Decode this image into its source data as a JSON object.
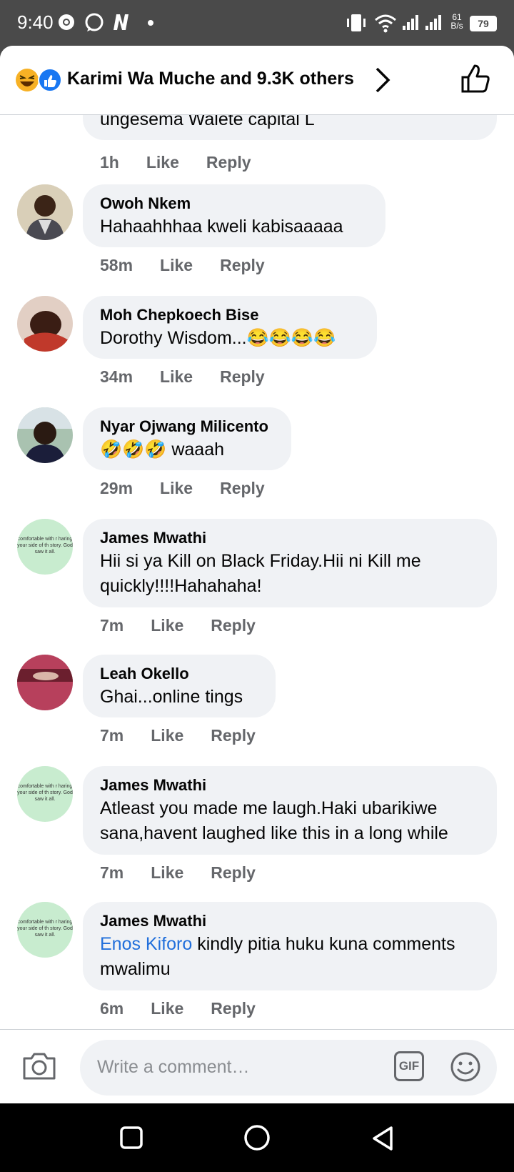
{
  "status_bar": {
    "time": "9:40",
    "speed_top": "61",
    "speed_unit": "B/s",
    "battery": "79"
  },
  "header": {
    "reactions_title": "Karimi Wa Muche and 9.3K others"
  },
  "comments": [
    {
      "name": "",
      "text": "ungesema Walete capital L",
      "time": "1h",
      "like": "Like",
      "reply": "Reply"
    },
    {
      "name": "Owoh Nkem",
      "text": "Hahaahhhaa kweli kabisaaaaa",
      "time": "58m",
      "like": "Like",
      "reply": "Reply"
    },
    {
      "name": "Moh Chepkoech Bise",
      "text": "Dorothy Wisdom...😂😂😂😂",
      "time": "34m",
      "like": "Like",
      "reply": "Reply"
    },
    {
      "name": "Nyar Ojwang Milicento",
      "text": "🤣🤣🤣 waaah",
      "time": "29m",
      "like": "Like",
      "reply": "Reply"
    },
    {
      "name": "James Mwathi",
      "text": "Hii si ya Kill on Black Friday.Hii ni Kill me quickly!!!!Hahahaha!",
      "time": "7m",
      "like": "Like",
      "reply": "Reply"
    },
    {
      "name": "Leah Okello",
      "text": "Ghai...online tings",
      "time": "7m",
      "like": "Like",
      "reply": "Reply"
    },
    {
      "name": "James Mwathi",
      "text": "Atleast you made me laugh.Haki ubarikiwe sana,havent laughed like this in a long while",
      "time": "7m",
      "like": "Like",
      "reply": "Reply"
    },
    {
      "name": "James Mwathi",
      "mention": "Enos Kiforo",
      "text": " kindly pitia huku kuna comments mwalimu",
      "time": "6m",
      "like": "Like",
      "reply": "Reply"
    }
  ],
  "avatar_text": "comfortable with r haring your side of th story. God saw it all.",
  "composer": {
    "placeholder": "Write a comment…",
    "gif_label": "GIF"
  },
  "colors": {
    "bubble": "#f0f2f5",
    "meta": "#65676b",
    "mention": "#216fdb",
    "like_blue": "#1877f2"
  }
}
